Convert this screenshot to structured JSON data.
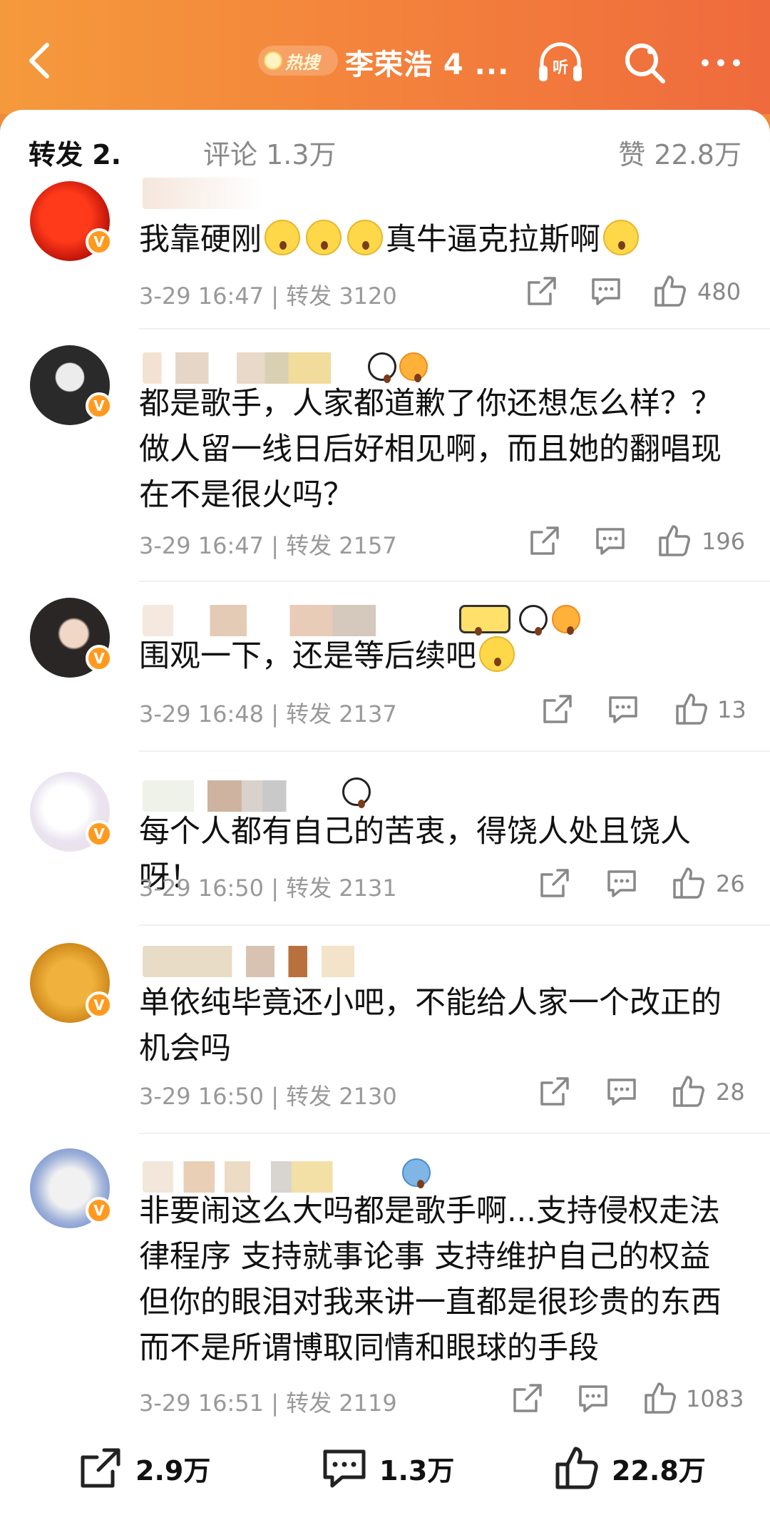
{
  "header": {
    "hot_tag": "热搜",
    "topic": "李荣浩 4 ...",
    "listen_label": "听"
  },
  "tabs": {
    "repost": "转发 2.",
    "comment": "评论 1.3万",
    "like": "赞 22.8万"
  },
  "comments": [
    {
      "text": "我靠硬刚",
      "text_tail": "真牛逼克拉斯啊",
      "time": "3-29 16:47",
      "repost": "转发 3120",
      "likes": "480"
    },
    {
      "text": "都是歌手，人家都道歉了你还想怎么样？？做人留一线日后好相见啊，而且她的翻唱现在不是很火吗？",
      "time": "3-29 16:47",
      "repost": "转发 2157",
      "likes": "196"
    },
    {
      "text": "围观一下，还是等后续吧",
      "time": "3-29 16:48",
      "repost": "转发 2137",
      "likes": "13"
    },
    {
      "text": "每个人都有自己的苦衷，得饶人处且饶人呀！",
      "time": "3-29 16:50",
      "repost": "转发 2131",
      "likes": "26"
    },
    {
      "text": "单依纯毕竟还小吧，不能给人家一个改正的机会吗",
      "time": "3-29 16:50",
      "repost": "转发 2130",
      "likes": "28"
    },
    {
      "text": "非要闹这么大吗都是歌手啊...支持侵权走法律程序 支持就事论事 支持维护自己的权益 但你的眼泪对我来讲一直都是很珍贵的东西 而不是所谓博取同情和眼球的手段",
      "time": "3-29 16:51",
      "repost": "转发 2119",
      "likes": "1083"
    }
  ],
  "bottom_bar": {
    "repost_count": "2.9万",
    "comment_count": "1.3万",
    "like_count": "22.8万"
  }
}
